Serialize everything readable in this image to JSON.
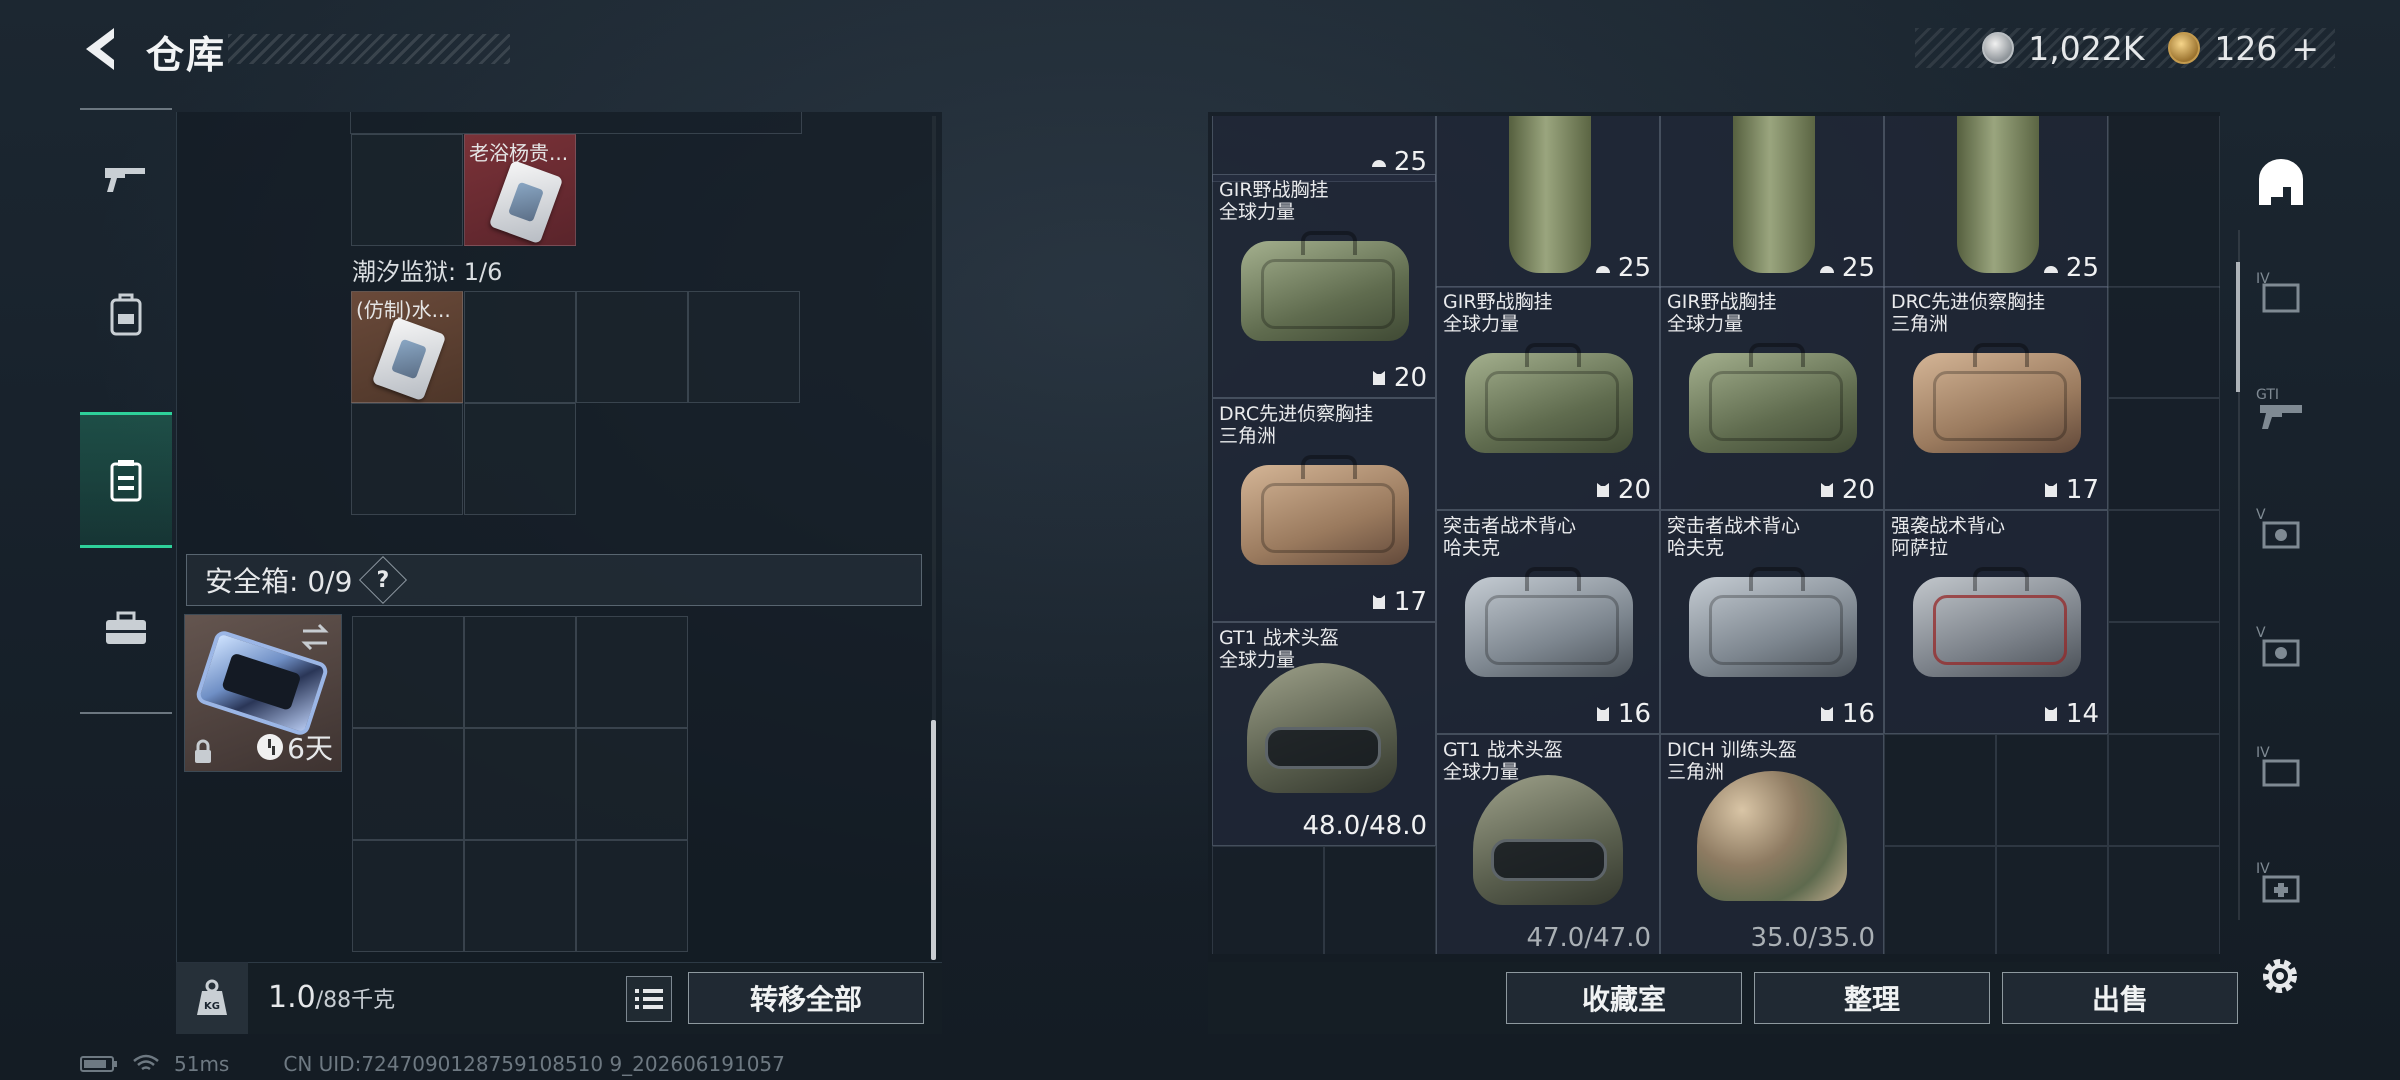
{
  "header": {
    "title": "仓库",
    "currencies": [
      {
        "icon": "silver-coin-icon",
        "value": "1,022K"
      },
      {
        "icon": "gold-coin-icon",
        "value": "126"
      }
    ],
    "add_label": "+"
  },
  "left_nav": [
    {
      "icon": "gun-icon"
    },
    {
      "icon": "backpack-icon"
    },
    {
      "icon": "container-icon",
      "active": true
    },
    {
      "icon": "toolbox-icon"
    }
  ],
  "inventory": {
    "top_item_name": "老浴杨贵...",
    "section_label": "潮汐监狱: 1/6",
    "section_item_name": "(仿制)水...",
    "safe_box_label": "安全箱: 0/9",
    "safe_help": "?",
    "safe_timer": "6天"
  },
  "bottom_left": {
    "weight_current": "1.0",
    "weight_max": "/88千克",
    "transfer_all": "转移全部",
    "kg_icon_label": "KG"
  },
  "storage_items": [
    {
      "name": "",
      "sub": "",
      "value": "25",
      "type": "roll"
    },
    {
      "name": "",
      "sub": "",
      "value": "25",
      "type": "roll"
    },
    {
      "name": "",
      "sub": "",
      "value": "25",
      "type": "roll"
    },
    {
      "name": "",
      "sub": "",
      "value": "25",
      "type": "roll"
    },
    {
      "name": "GIR野战胸挂",
      "sub": "全球力量",
      "value": "20",
      "type": "bag-green"
    },
    {
      "name": "GIR野战胸挂",
      "sub": "全球力量",
      "value": "20",
      "type": "bag-green"
    },
    {
      "name": "GIR野战胸挂",
      "sub": "全球力量",
      "value": "20",
      "type": "bag-green"
    },
    {
      "name": "DRC先进侦察胸挂",
      "sub": "三角洲",
      "value": "17",
      "type": "bag-tan"
    },
    {
      "name": "DRC先进侦察胸挂",
      "sub": "三角洲",
      "value": "17",
      "type": "bag-tan"
    },
    {
      "name": "突击者战术背心",
      "sub": "哈夫克",
      "value": "16",
      "type": "bag-gray"
    },
    {
      "name": "突击者战术背心",
      "sub": "哈夫克",
      "value": "16",
      "type": "bag-gray"
    },
    {
      "name": "强袭战术背心",
      "sub": "阿萨拉",
      "value": "14",
      "type": "bag-grayred"
    },
    {
      "name": "GT1 战术头盔",
      "sub": "全球力量",
      "value": "48.0/48.0",
      "type": "helmet-olive"
    },
    {
      "name": "GT1 战术头盔",
      "sub": "全球力量",
      "value": "47.0/47.0",
      "type": "helmet-olive"
    },
    {
      "name": "DICH 训练头盔",
      "sub": "三角洲",
      "value": "35.0/35.0",
      "type": "helmet-camo"
    }
  ],
  "bottom_right": {
    "collection": "收藏室",
    "organize": "整理",
    "sell": "出售"
  },
  "right_nav": [
    {
      "icon": "home-icon",
      "label": ""
    },
    {
      "icon": "vest-tier-icon",
      "label": "IV"
    },
    {
      "icon": "gun-tier-icon",
      "label": "GTI"
    },
    {
      "icon": "vest-tier-icon",
      "label": "V"
    },
    {
      "icon": "vest-tier-icon",
      "label": "V"
    },
    {
      "icon": "vest-tier-icon",
      "label": "IV"
    },
    {
      "icon": "med-tier-icon",
      "label": "IV"
    }
  ],
  "status": {
    "ping": "51ms",
    "uid": "CN UID:7247090128759108510 9_202606191057"
  },
  "colors": {
    "accent": "#2ed19a"
  }
}
